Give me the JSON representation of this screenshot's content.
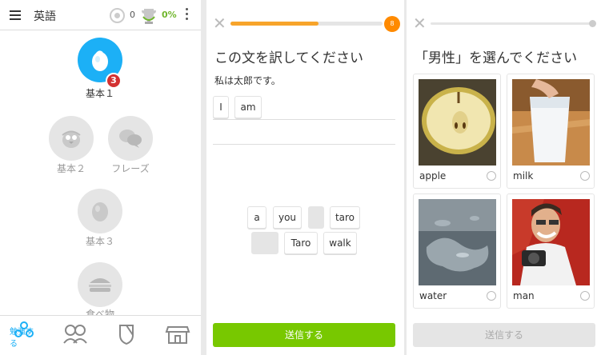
{
  "panel1": {
    "language": "英語",
    "streak_count": "0",
    "progress_percent": "0%",
    "skills": [
      {
        "label": "基本１",
        "level_badge": "3",
        "active": true
      },
      {
        "label": "基本２"
      },
      {
        "label": "フレーズ"
      },
      {
        "label": "基本３"
      },
      {
        "label": "食べ物"
      }
    ],
    "nav": {
      "learn_label": "勉強する"
    },
    "colors": {
      "accent": "#1cb0f6",
      "badge": "#d33131",
      "green": "#71b62e"
    }
  },
  "panel2": {
    "progress_fraction": 0.58,
    "streak_badge": "8",
    "title": "この文を訳してください",
    "sentence": "私は太郎です。",
    "answer_words": [
      "I",
      "am"
    ],
    "word_bank": [
      "a",
      "you",
      "",
      "taro",
      "",
      "Taro",
      "walk"
    ],
    "submit_label": "送信する",
    "colors": {
      "progress": "#f7a42a",
      "submit": "#78c800"
    }
  },
  "panel3": {
    "title": "「男性」を選んでください",
    "options": [
      "apple",
      "milk",
      "water",
      "man"
    ],
    "submit_label": "送信する"
  }
}
